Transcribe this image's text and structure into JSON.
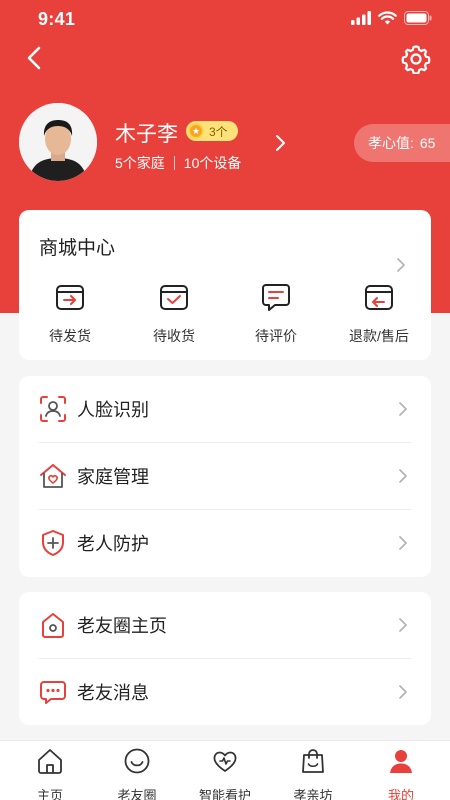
{
  "status_bar": {
    "time": "9:41"
  },
  "colors": {
    "accent": "#e8403a",
    "badge": "#ffe27a"
  },
  "header": {
    "back_icon": "back-arrow-icon",
    "settings_icon": "gear-icon"
  },
  "profile": {
    "name": "木子李",
    "level": "3个",
    "families": "5个家庭",
    "devices": "10个设备",
    "xiaoxin_label": "孝心值:",
    "xiaoxin_value": "65"
  },
  "mall": {
    "title": "商城中心",
    "orders": [
      {
        "label": "待发货",
        "icon": "box-arrow-icon"
      },
      {
        "label": "待收货",
        "icon": "box-check-icon"
      },
      {
        "label": "待评价",
        "icon": "comment-icon"
      },
      {
        "label": "退款/售后",
        "icon": "box-return-icon"
      }
    ]
  },
  "menu_group_1": [
    {
      "label": "人脸识别",
      "icon": "face-scan-icon"
    },
    {
      "label": "家庭管理",
      "icon": "home-heart-icon"
    },
    {
      "label": "老人防护",
      "icon": "shield-plus-icon"
    }
  ],
  "menu_group_2": [
    {
      "label": "老友圈主页",
      "icon": "friend-home-icon"
    },
    {
      "label": "老友消息",
      "icon": "chat-bubble-icon"
    }
  ],
  "tabbar": [
    {
      "label": "主页",
      "icon": "home-icon"
    },
    {
      "label": "老友圈",
      "icon": "smile-icon"
    },
    {
      "label": "智能看护",
      "icon": "heart-care-icon"
    },
    {
      "label": "孝亲坊",
      "icon": "shopping-bag-icon"
    },
    {
      "label": "我的",
      "icon": "user-icon",
      "active": true
    }
  ]
}
